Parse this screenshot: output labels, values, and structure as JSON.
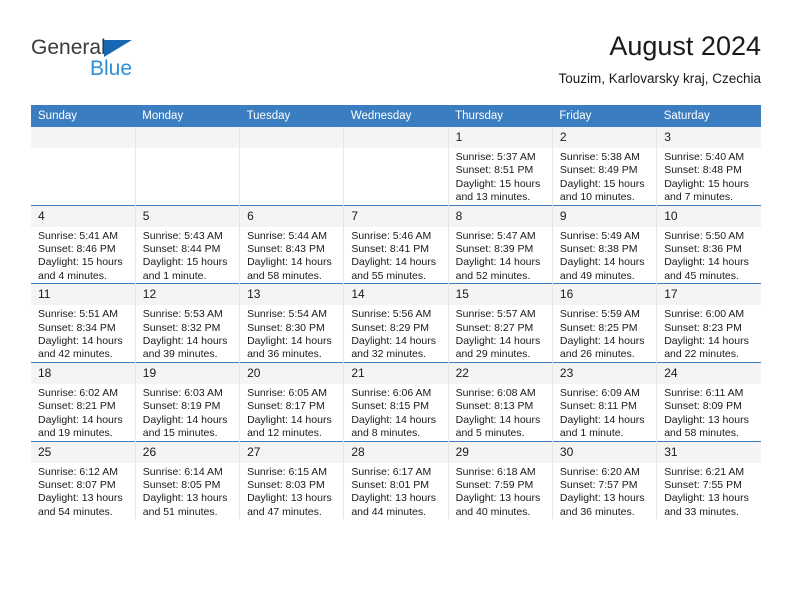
{
  "brand": {
    "name_part1": "General",
    "name_part2": "Blue",
    "triangle_color": "#1668b3",
    "blue_text_color": "#2d8fd5"
  },
  "header": {
    "title": "August 2024",
    "subtitle": "Touzim, Karlovarsky kraj, Czechia"
  },
  "calendar": {
    "header_bg": "#3a7dc0",
    "daynum_bg": "#f4f4f4",
    "weekdays": [
      "Sunday",
      "Monday",
      "Tuesday",
      "Wednesday",
      "Thursday",
      "Friday",
      "Saturday"
    ],
    "weeks": [
      [
        {
          "day": "",
          "empty": true
        },
        {
          "day": "",
          "empty": true
        },
        {
          "day": "",
          "empty": true
        },
        {
          "day": "",
          "empty": true
        },
        {
          "day": "1",
          "sunrise": "Sunrise: 5:37 AM",
          "sunset": "Sunset: 8:51 PM",
          "daylight": "Daylight: 15 hours and 13 minutes."
        },
        {
          "day": "2",
          "sunrise": "Sunrise: 5:38 AM",
          "sunset": "Sunset: 8:49 PM",
          "daylight": "Daylight: 15 hours and 10 minutes."
        },
        {
          "day": "3",
          "sunrise": "Sunrise: 5:40 AM",
          "sunset": "Sunset: 8:48 PM",
          "daylight": "Daylight: 15 hours and 7 minutes."
        }
      ],
      [
        {
          "day": "4",
          "sunrise": "Sunrise: 5:41 AM",
          "sunset": "Sunset: 8:46 PM",
          "daylight": "Daylight: 15 hours and 4 minutes."
        },
        {
          "day": "5",
          "sunrise": "Sunrise: 5:43 AM",
          "sunset": "Sunset: 8:44 PM",
          "daylight": "Daylight: 15 hours and 1 minute."
        },
        {
          "day": "6",
          "sunrise": "Sunrise: 5:44 AM",
          "sunset": "Sunset: 8:43 PM",
          "daylight": "Daylight: 14 hours and 58 minutes."
        },
        {
          "day": "7",
          "sunrise": "Sunrise: 5:46 AM",
          "sunset": "Sunset: 8:41 PM",
          "daylight": "Daylight: 14 hours and 55 minutes."
        },
        {
          "day": "8",
          "sunrise": "Sunrise: 5:47 AM",
          "sunset": "Sunset: 8:39 PM",
          "daylight": "Daylight: 14 hours and 52 minutes."
        },
        {
          "day": "9",
          "sunrise": "Sunrise: 5:49 AM",
          "sunset": "Sunset: 8:38 PM",
          "daylight": "Daylight: 14 hours and 49 minutes."
        },
        {
          "day": "10",
          "sunrise": "Sunrise: 5:50 AM",
          "sunset": "Sunset: 8:36 PM",
          "daylight": "Daylight: 14 hours and 45 minutes."
        }
      ],
      [
        {
          "day": "11",
          "sunrise": "Sunrise: 5:51 AM",
          "sunset": "Sunset: 8:34 PM",
          "daylight": "Daylight: 14 hours and 42 minutes."
        },
        {
          "day": "12",
          "sunrise": "Sunrise: 5:53 AM",
          "sunset": "Sunset: 8:32 PM",
          "daylight": "Daylight: 14 hours and 39 minutes."
        },
        {
          "day": "13",
          "sunrise": "Sunrise: 5:54 AM",
          "sunset": "Sunset: 8:30 PM",
          "daylight": "Daylight: 14 hours and 36 minutes."
        },
        {
          "day": "14",
          "sunrise": "Sunrise: 5:56 AM",
          "sunset": "Sunset: 8:29 PM",
          "daylight": "Daylight: 14 hours and 32 minutes."
        },
        {
          "day": "15",
          "sunrise": "Sunrise: 5:57 AM",
          "sunset": "Sunset: 8:27 PM",
          "daylight": "Daylight: 14 hours and 29 minutes."
        },
        {
          "day": "16",
          "sunrise": "Sunrise: 5:59 AM",
          "sunset": "Sunset: 8:25 PM",
          "daylight": "Daylight: 14 hours and 26 minutes."
        },
        {
          "day": "17",
          "sunrise": "Sunrise: 6:00 AM",
          "sunset": "Sunset: 8:23 PM",
          "daylight": "Daylight: 14 hours and 22 minutes."
        }
      ],
      [
        {
          "day": "18",
          "sunrise": "Sunrise: 6:02 AM",
          "sunset": "Sunset: 8:21 PM",
          "daylight": "Daylight: 14 hours and 19 minutes."
        },
        {
          "day": "19",
          "sunrise": "Sunrise: 6:03 AM",
          "sunset": "Sunset: 8:19 PM",
          "daylight": "Daylight: 14 hours and 15 minutes."
        },
        {
          "day": "20",
          "sunrise": "Sunrise: 6:05 AM",
          "sunset": "Sunset: 8:17 PM",
          "daylight": "Daylight: 14 hours and 12 minutes."
        },
        {
          "day": "21",
          "sunrise": "Sunrise: 6:06 AM",
          "sunset": "Sunset: 8:15 PM",
          "daylight": "Daylight: 14 hours and 8 minutes."
        },
        {
          "day": "22",
          "sunrise": "Sunrise: 6:08 AM",
          "sunset": "Sunset: 8:13 PM",
          "daylight": "Daylight: 14 hours and 5 minutes."
        },
        {
          "day": "23",
          "sunrise": "Sunrise: 6:09 AM",
          "sunset": "Sunset: 8:11 PM",
          "daylight": "Daylight: 14 hours and 1 minute."
        },
        {
          "day": "24",
          "sunrise": "Sunrise: 6:11 AM",
          "sunset": "Sunset: 8:09 PM",
          "daylight": "Daylight: 13 hours and 58 minutes."
        }
      ],
      [
        {
          "day": "25",
          "sunrise": "Sunrise: 6:12 AM",
          "sunset": "Sunset: 8:07 PM",
          "daylight": "Daylight: 13 hours and 54 minutes."
        },
        {
          "day": "26",
          "sunrise": "Sunrise: 6:14 AM",
          "sunset": "Sunset: 8:05 PM",
          "daylight": "Daylight: 13 hours and 51 minutes."
        },
        {
          "day": "27",
          "sunrise": "Sunrise: 6:15 AM",
          "sunset": "Sunset: 8:03 PM",
          "daylight": "Daylight: 13 hours and 47 minutes."
        },
        {
          "day": "28",
          "sunrise": "Sunrise: 6:17 AM",
          "sunset": "Sunset: 8:01 PM",
          "daylight": "Daylight: 13 hours and 44 minutes."
        },
        {
          "day": "29",
          "sunrise": "Sunrise: 6:18 AM",
          "sunset": "Sunset: 7:59 PM",
          "daylight": "Daylight: 13 hours and 40 minutes."
        },
        {
          "day": "30",
          "sunrise": "Sunrise: 6:20 AM",
          "sunset": "Sunset: 7:57 PM",
          "daylight": "Daylight: 13 hours and 36 minutes."
        },
        {
          "day": "31",
          "sunrise": "Sunrise: 6:21 AM",
          "sunset": "Sunset: 7:55 PM",
          "daylight": "Daylight: 13 hours and 33 minutes."
        }
      ]
    ]
  }
}
